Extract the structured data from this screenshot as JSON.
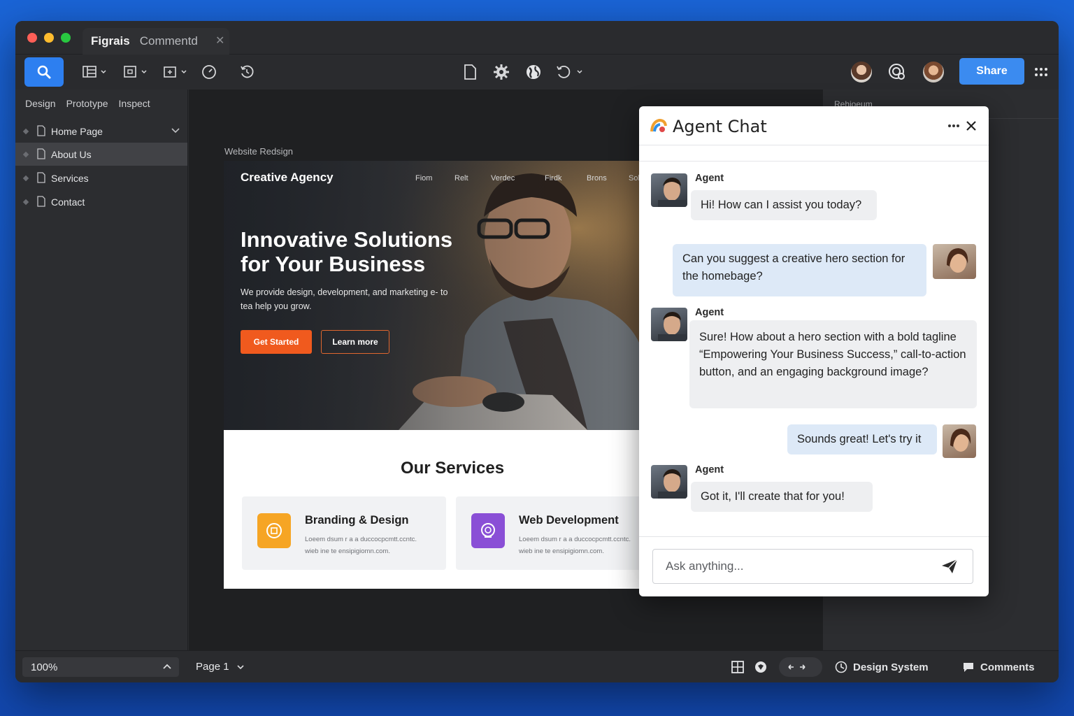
{
  "window": {
    "app_name": "Figrais",
    "doc_tab": "Commentd"
  },
  "toolbar": {
    "share_label": "Share",
    "accent": "#2d7ff0"
  },
  "left_panel": {
    "tabs": [
      "Design",
      "Prototype",
      "Inspect"
    ],
    "pages": [
      {
        "label": "Home Page",
        "active": false,
        "expandable": true
      },
      {
        "label": "About Us",
        "active": true
      },
      {
        "label": "Services",
        "active": false
      },
      {
        "label": "Contact",
        "active": false
      }
    ]
  },
  "canvas": {
    "frame_label": "Website Redsign",
    "hero": {
      "brand": "Creative Agency",
      "nav": [
        "Fiom",
        "Relt",
        "Verdec",
        "Firdk",
        "Brons",
        "Sol"
      ],
      "title": "Innovative Solutions for Your Business",
      "subtitle": "We provide design, development, and marketing e- to tea help you grow.",
      "primary_cta": "Get Started",
      "secondary_cta": "Learn more"
    },
    "services": {
      "title": "Our Services",
      "cards": [
        {
          "title": "Branding & Design",
          "text": "Loeem dsum r a a duccocpcmtt.ccntc. wieb ine te ensipigiomn.com.",
          "icon": "badge-icon",
          "color": "#f6a524"
        },
        {
          "title": "Web Development",
          "text": "Loeem dsum r a a duccocpcmtt.ccntc. wieb ine te ensipigiomn.com.",
          "icon": "globe-icon",
          "color": "#8a4fd6"
        }
      ]
    }
  },
  "right_panel": {
    "header": "Rehioeum"
  },
  "bottom_bar": {
    "zoom": "100%",
    "page": "Page 1",
    "design_system": "Design System",
    "comments": "Comments"
  },
  "chat": {
    "title": "Agent Chat",
    "messages": [
      {
        "from": "agent",
        "name": "Agent",
        "text": "Hi! How can I assist you today?"
      },
      {
        "from": "user",
        "text": "Can you suggest a creative hero section for the homebage?"
      },
      {
        "from": "agent",
        "name": "Agent",
        "text": "Sure! How about a hero section with a bold tagline “Empowering Your Business Success,” call-to-action button, and an engaging background image?"
      },
      {
        "from": "user",
        "text": "Sounds great! Let's try it"
      },
      {
        "from": "agent",
        "name": "Agent",
        "text": "Got it, I'll create that for you!"
      }
    ],
    "input_placeholder": "Ask anything..."
  }
}
